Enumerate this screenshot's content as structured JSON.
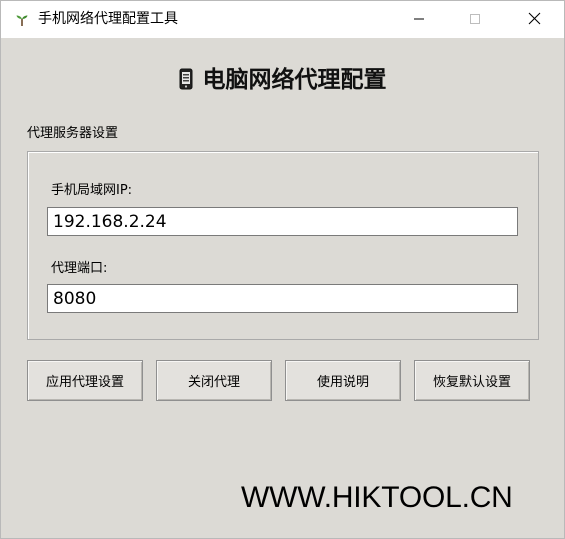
{
  "window": {
    "title": "手机网络代理配置工具",
    "app_icon": "sprout-icon",
    "controls": [
      "minimize-icon",
      "maximize-icon",
      "close-icon"
    ]
  },
  "heading": {
    "icon": "mobile-phone-icon",
    "text": "电脑网络代理配置"
  },
  "proxy_group": {
    "label": "代理服务器设置",
    "ip_label": "手机局域网IP:",
    "ip_value": "192.168.2.24",
    "port_label": "代理端口:",
    "port_value": "8080"
  },
  "buttons": {
    "apply": "应用代理设置",
    "disable": "关闭代理",
    "help": "使用说明",
    "reset": "恢复默认设置"
  },
  "watermark": "WWW.HIKTOOL.CN",
  "colors": {
    "window_bg": "#dcdad5",
    "titlebar_bg": "#ffffff",
    "input_bg": "#ffffff"
  }
}
